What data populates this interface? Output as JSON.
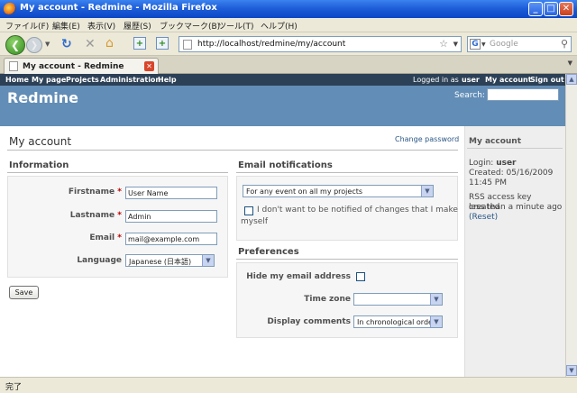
{
  "window": {
    "title": "My account - Redmine - Mozilla Firefox"
  },
  "menu": [
    "ファイル(F)",
    "編集(E)",
    "表示(V)",
    "履歴(S)",
    "ブックマーク(B)",
    "ツール(T)",
    "ヘルプ(H)"
  ],
  "browser": {
    "url": "http://localhost/redmine/my/account",
    "search_placeholder": "Google",
    "tab_title": "My account - Redmine",
    "status": "完了"
  },
  "topmenu": {
    "left": [
      "Home",
      "My page",
      "Projects",
      "Administration",
      "Help"
    ],
    "logged_prefix": "Logged in as",
    "user": "user",
    "my_account": "My account",
    "sign_out": "Sign out"
  },
  "header": {
    "title": "Redmine",
    "search_label": "Search:"
  },
  "page": {
    "title": "My account",
    "change_password": "Change password"
  },
  "information": {
    "heading": "Information",
    "firstname_label": "Firstname",
    "firstname": "User Name",
    "lastname_label": "Lastname",
    "lastname": "Admin",
    "email_label": "Email",
    "email": "mail@example.com",
    "language_label": "Language",
    "language": "Japanese (日本語)",
    "required_mark": "*"
  },
  "save_label": "Save",
  "email_notifications": {
    "heading": "Email notifications",
    "option": "For any event on all my projects",
    "no_self_line1": "I don't want to be notified of changes that I make",
    "no_self_line2": "myself"
  },
  "preferences": {
    "heading": "Preferences",
    "hide_mail_label": "Hide my email address",
    "time_zone_label": "Time zone",
    "time_zone": "",
    "comments_label": "Display comments",
    "comments": "In chronological order"
  },
  "sidebar": {
    "heading": "My account",
    "login_label": "Login:",
    "login": "user",
    "created_line1": "Created: 05/16/2009",
    "created_line2": "11:45 PM",
    "rss_line1": "RSS access key created",
    "rss_line2": "less than a minute ago",
    "reset": "(Reset)"
  },
  "colors": {
    "header": "#628db6",
    "topmenu": "#2c4056",
    "link": "#2a5685",
    "required": "#bb0000"
  }
}
